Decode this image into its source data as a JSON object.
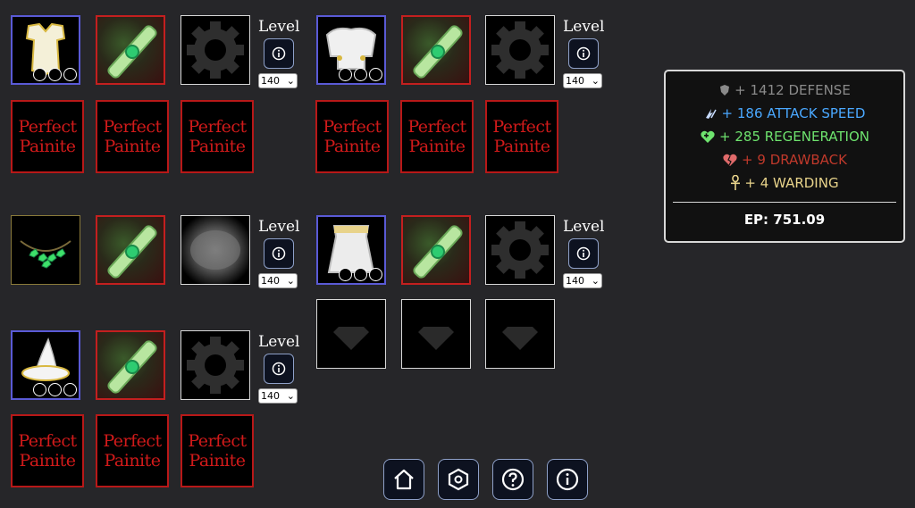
{
  "level_label": "Level",
  "perfect_painite_label": "Perfect\nPainite",
  "level_value": "140",
  "stats": {
    "defense": "+ 1412 DEFENSE",
    "attack_speed": "+ 186 ATTACK SPEED",
    "regeneration": "+ 285 REGENERATION",
    "drawback": "+ 9 DRAWBACK",
    "warding": "+ 4 WARDING",
    "ep": "EP: 751.09"
  },
  "colors": {
    "defense": "#8a8a8a",
    "attack_speed": "#4aa8ff",
    "regeneration": "#6ee36e",
    "drawback": "#c0392b",
    "warding": "#e8d38a"
  },
  "nav": [
    "home-icon",
    "hexagon-settings-icon",
    "help-icon",
    "info-icon"
  ]
}
